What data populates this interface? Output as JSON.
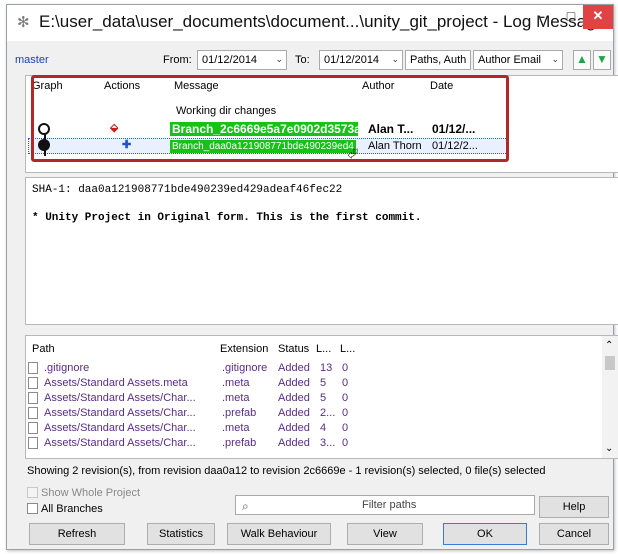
{
  "window": {
    "title": "E:\\user_data\\user_documents\\document...\\unity_git_project - Log Messages ...",
    "minimize_glyph": "–",
    "maximize_glyph": "□",
    "close_glyph": "✕"
  },
  "toolbar": {
    "branch": "master",
    "from_label": "From:",
    "from_date": "01/12/2014",
    "to_label": "To:",
    "to_date": "01/12/2014",
    "paths_combo": "Paths, Auth",
    "author_email_combo": "Author Email",
    "combo_arrow": "⌄",
    "up_arrow": "▲",
    "down_arrow": "▼"
  },
  "log": {
    "columns": [
      "Graph",
      "Actions",
      "Message",
      "Author",
      "Date"
    ],
    "working_dir": "Working dir changes",
    "rows": [
      {
        "message": "Branch_2c6669e5a7e0902d3573ab",
        "author": "Alan T...",
        "date": "01/12/..."
      },
      {
        "message": "Branch_daa0a121908771bde490239ed4",
        "author": "Alan Thorn",
        "date": "01/12/2..."
      }
    ]
  },
  "details": {
    "sha_line": "SHA-1: daa0a121908771bde490239ed429adeaf46fec22",
    "commit_message": "* Unity Project in Original form. This is the first commit."
  },
  "files": {
    "columns": [
      "Path",
      "Extension",
      "Status",
      "L...",
      "L..."
    ],
    "rows": [
      {
        "path": ".gitignore",
        "ext": ".gitignore",
        "status": "Added",
        "l1": "13",
        "l2": "0"
      },
      {
        "path": "Assets/Standard Assets.meta",
        "ext": ".meta",
        "status": "Added",
        "l1": "5",
        "l2": "0"
      },
      {
        "path": "Assets/Standard Assets/Char...",
        "ext": ".meta",
        "status": "Added",
        "l1": "5",
        "l2": "0"
      },
      {
        "path": "Assets/Standard Assets/Char...",
        "ext": ".prefab",
        "status": "Added",
        "l1": "2...",
        "l2": "0"
      },
      {
        "path": "Assets/Standard Assets/Char...",
        "ext": ".meta",
        "status": "Added",
        "l1": "4",
        "l2": "0"
      },
      {
        "path": "Assets/Standard Assets/Char...",
        "ext": ".prefab",
        "status": "Added",
        "l1": "3...",
        "l2": "0"
      }
    ]
  },
  "status_line": "Showing 2 revision(s), from revision daa0a12 to revision 2c6669e - 1 revision(s) selected, 0 file(s) selected",
  "options": {
    "show_whole_project": "Show Whole Project",
    "all_branches": "All Branches"
  },
  "filter": {
    "placeholder": "Filter paths"
  },
  "buttons": {
    "help": "Help",
    "refresh": "Refresh",
    "statistics": "Statistics",
    "walk_behaviour": "Walk Behaviour",
    "view": "View",
    "ok": "OK",
    "cancel": "Cancel"
  },
  "colors": {
    "branch_label": "#17c217",
    "highlight_box": "#b02828",
    "close_button": "#e04343"
  },
  "icons": {
    "app": "tortoisegit-icon",
    "filter": "magnifier-icon"
  }
}
